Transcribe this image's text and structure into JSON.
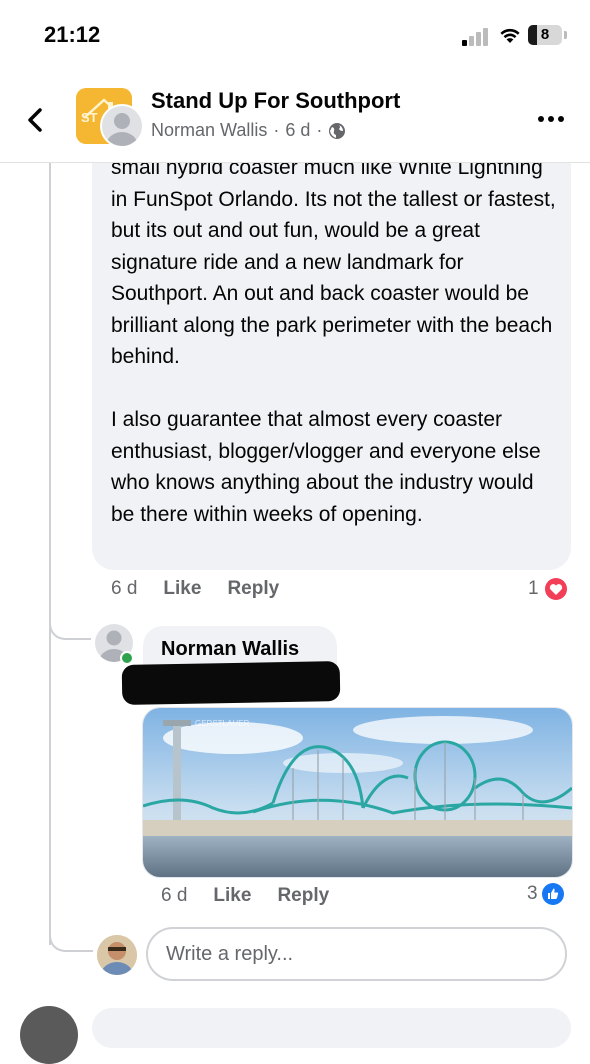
{
  "status_bar": {
    "time": "21:12",
    "battery": "8"
  },
  "header": {
    "group_name": "Stand Up For Southport",
    "author": "Norman Wallis",
    "age": "6 d",
    "separator": "·",
    "logo_text": "ST",
    "icons": {
      "back": "chevron-left-icon",
      "privacy": "globe-icon",
      "more": "more-dots-icon"
    }
  },
  "comment": {
    "text": "small hybrid coaster much like White Lightning in FunSpot Orlando. Its not the tallest or fastest, but its out and out fun, would be a great signature ride and a new landmark for Southport. An out and back coaster would be brilliant along the park perimeter with the beach behind.\n\nI also guarantee that almost every coaster enthusiast, blogger/vlogger and everyone else who knows anything about the industry would be there within weeks of opening.",
    "age": "6 d",
    "like_label": "Like",
    "reply_label": "Reply",
    "reaction_count": "1",
    "reaction": "love-icon"
  },
  "reply": {
    "author": "Norman Wallis",
    "age": "6 d",
    "like_label": "Like",
    "reply_label": "Reply",
    "reaction_count": "3",
    "reaction": "like-icon",
    "image_watermark": "GERSTLAUER"
  },
  "write_reply": {
    "placeholder": "Write a reply..."
  },
  "colors": {
    "bubble": "#f0f2f5",
    "meta": "#65676b",
    "love": "#f33e58",
    "like": "#1877f2",
    "online": "#31a24c"
  }
}
